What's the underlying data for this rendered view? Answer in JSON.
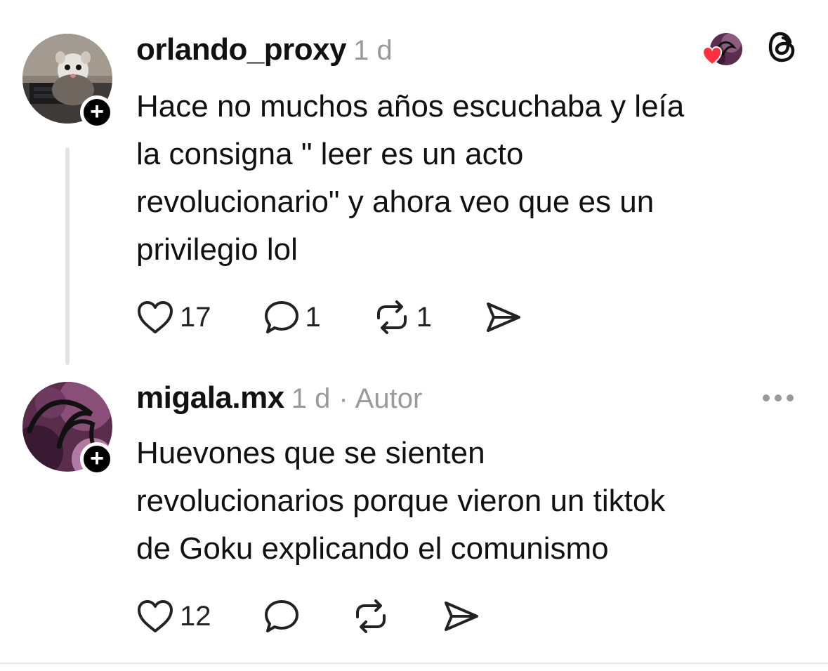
{
  "posts": [
    {
      "username": "orlando_proxy",
      "time": "1 d",
      "text": "Hace no muchos años escuchaba y leía\nla consigna \" leer es un acto\nrevolucionario\" y ahora veo que es un\nprivilegio lol",
      "likes": "17",
      "replies": "1",
      "reposts": "1",
      "icons": [
        "heart-icon",
        "comment-icon",
        "repost-icon",
        "share-icon",
        "threads-logo-icon"
      ]
    },
    {
      "username": "migala.mx",
      "time": "1 d",
      "separator": "·",
      "author_tag": "Autor",
      "text": "Huevones que se sienten\nrevolucionarios porque vieron un tiktok\nde Goku explicando el comunismo",
      "likes": "12",
      "icons": [
        "heart-icon",
        "comment-icon",
        "repost-icon",
        "share-icon",
        "more-icon"
      ]
    }
  ],
  "colors": {
    "text": "#111111",
    "muted": "#9a9a9a",
    "like_badge": "#ff3040",
    "thread_line": "#e4e4e4"
  }
}
